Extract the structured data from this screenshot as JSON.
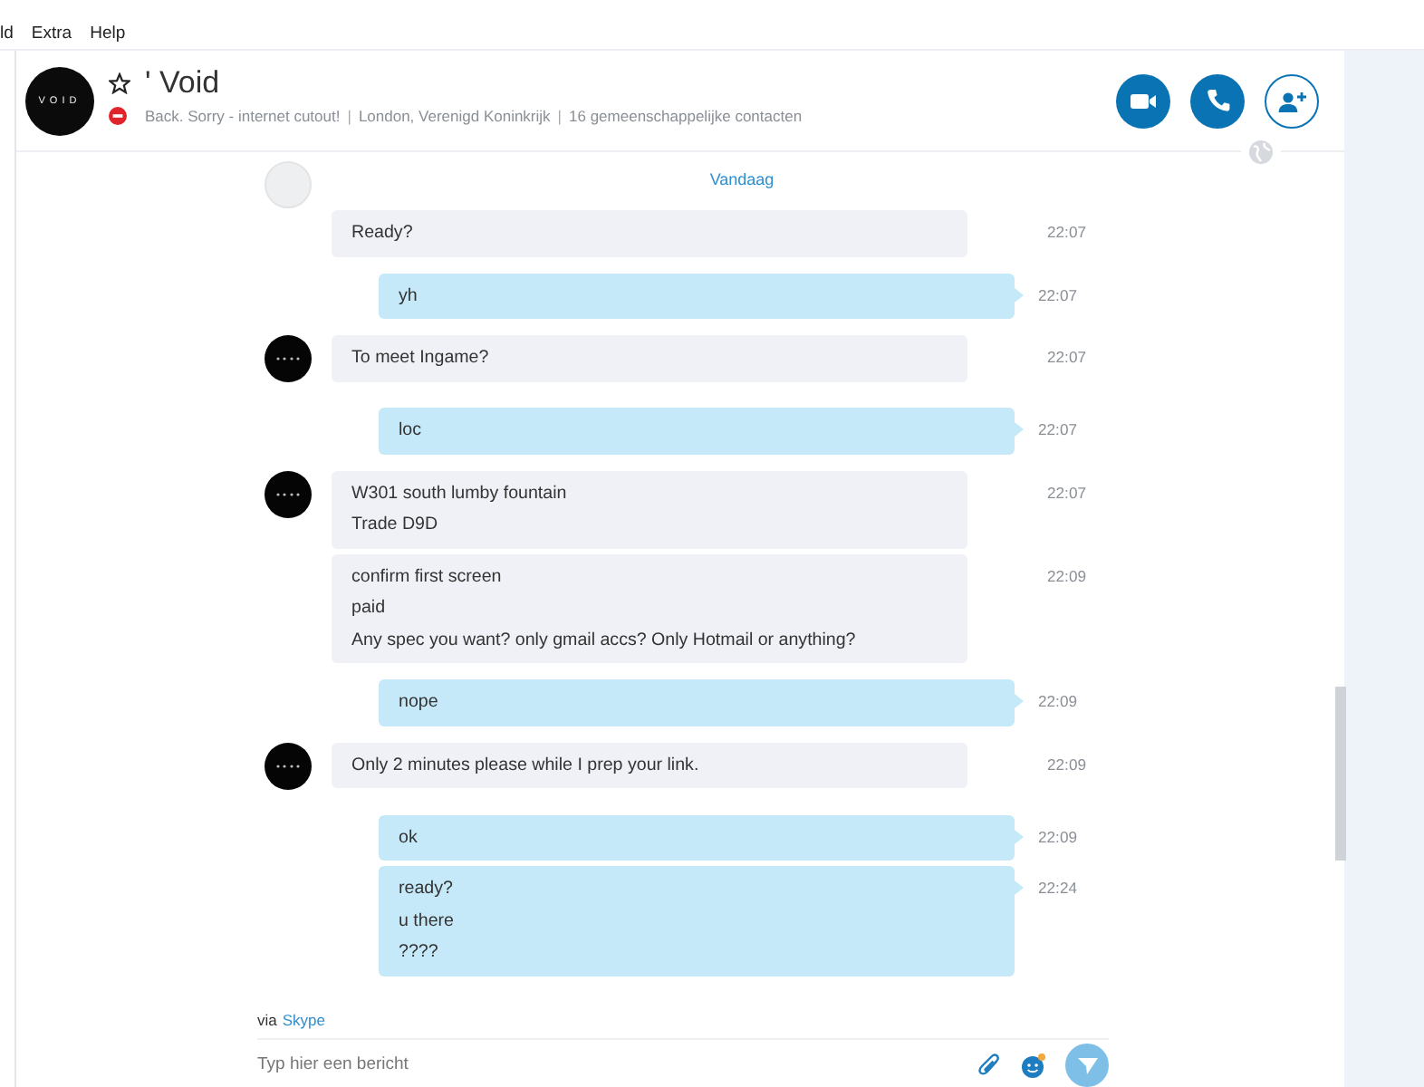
{
  "menu": [
    "ld",
    "Extra",
    "Help"
  ],
  "header": {
    "avatar_text": "VOID",
    "favorite": false,
    "title": "' Void",
    "busy": true,
    "separator": "|",
    "status": [
      "Back. Sorry - internet cutout!",
      "London, Verenigd Koninkrijk",
      "16 gemeenschappelijke contacten"
    ]
  },
  "day_separator": "Vandaag",
  "conversation": [
    {
      "kind": "incoming",
      "avatar": true,
      "avatar_faded": true,
      "bubbles": [
        {
          "lines": [
            "Ready?"
          ],
          "time": "22:07"
        }
      ]
    },
    {
      "kind": "outgoing",
      "bubbles": [
        {
          "lines": [
            "yh"
          ],
          "time": "22:07"
        }
      ]
    },
    {
      "kind": "incoming",
      "avatar": true,
      "avatar_faded": false,
      "bubbles": [
        {
          "lines": [
            "To meet Ingame?"
          ],
          "time": "22:07"
        }
      ]
    },
    {
      "kind": "outgoing",
      "bubbles": [
        {
          "lines": [
            "loc"
          ],
          "time": "22:07"
        }
      ]
    },
    {
      "kind": "incoming",
      "avatar": true,
      "avatar_faded": false,
      "bubbles": [
        {
          "lines": [
            "W301 south lumby fountain",
            "Trade D9D"
          ],
          "time": "22:07"
        },
        {
          "lines": [
            "confirm first screen",
            "paid",
            "Any spec you want? only gmail accs? Only Hotmail or anything?"
          ],
          "time": "22:09"
        }
      ]
    },
    {
      "kind": "outgoing",
      "bubbles": [
        {
          "lines": [
            "nope"
          ],
          "time": "22:09"
        }
      ]
    },
    {
      "kind": "incoming",
      "avatar": true,
      "avatar_faded": false,
      "bubbles": [
        {
          "lines": [
            "Only 2 minutes please while I prep your link."
          ],
          "time": "22:09"
        }
      ]
    },
    {
      "kind": "outgoing",
      "bubbles": [
        {
          "lines": [
            "ok"
          ],
          "time": "22:09"
        },
        {
          "lines": [
            "ready?",
            "u there",
            "????"
          ],
          "time": "22:24"
        }
      ]
    }
  ],
  "composer": {
    "via": "via",
    "via_link": "Skype",
    "placeholder": "Typ hier een bericht"
  }
}
